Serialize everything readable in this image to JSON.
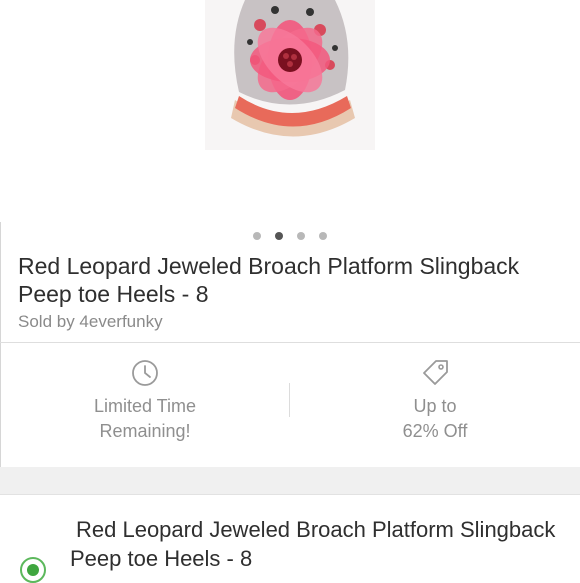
{
  "listing": {
    "title": " Red Leopard Jeweled Broach Platform Slingback Peep toe Heels  - 8",
    "seller": "Sold by 4everfunky",
    "carousel": {
      "count": 4,
      "active_index": 1
    }
  },
  "promo": {
    "time_label_line1": "Limited Time",
    "time_label_line2": "Remaining!",
    "discount_line1": "Up to",
    "discount_line2": "62% Off"
  },
  "selection": {
    "item_title": "Red Leopard Jeweled Broach Platform Slingback Peep toe Heels  - 8",
    "selected": true
  },
  "colors": {
    "accent_green": "#3fa63f",
    "flower_pink": "#f0507a"
  },
  "icons": {
    "time": "clock-icon",
    "discount": "tag-icon"
  }
}
